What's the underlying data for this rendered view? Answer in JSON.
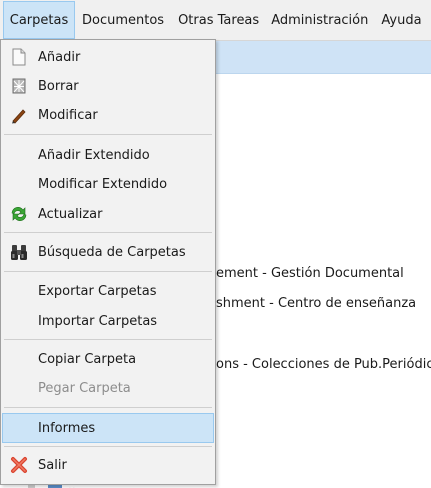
{
  "menubar": {
    "items": [
      {
        "label": "Carpetas"
      },
      {
        "label": "Documentos"
      },
      {
        "label": "Otras Tareas"
      },
      {
        "label": "Administración"
      },
      {
        "label": "Ayuda"
      }
    ]
  },
  "menu": {
    "items": [
      {
        "label": "Añadir",
        "icon": "new-document-icon"
      },
      {
        "label": "Borrar",
        "icon": "delete-document-icon"
      },
      {
        "label": "Modificar",
        "icon": "edit-pencil-icon"
      },
      {
        "label": "Añadir Extendido"
      },
      {
        "label": "Modificar Extendido"
      },
      {
        "label": "Actualizar",
        "icon": "refresh-icon"
      },
      {
        "label": "Búsqueda de Carpetas",
        "icon": "binoculars-icon"
      },
      {
        "label": "Exportar Carpetas"
      },
      {
        "label": "Importar Carpetas"
      },
      {
        "label": "Copiar Carpeta"
      },
      {
        "label": "Pegar Carpeta",
        "disabled": true
      },
      {
        "label": "Informes",
        "highlighted": true
      },
      {
        "label": "Salir",
        "icon": "exit-icon"
      }
    ]
  },
  "background": {
    "rows": [
      "ement - Gestión Documental",
      "shment - Centro de enseñanza",
      "ons - Colecciones de Pub.Periódica"
    ]
  },
  "colors": {
    "menu_bg": "#f2f2f2",
    "highlight": "#cce4f7",
    "highlight_border": "#99c9ef",
    "disabled_text": "#8d8d8d"
  }
}
